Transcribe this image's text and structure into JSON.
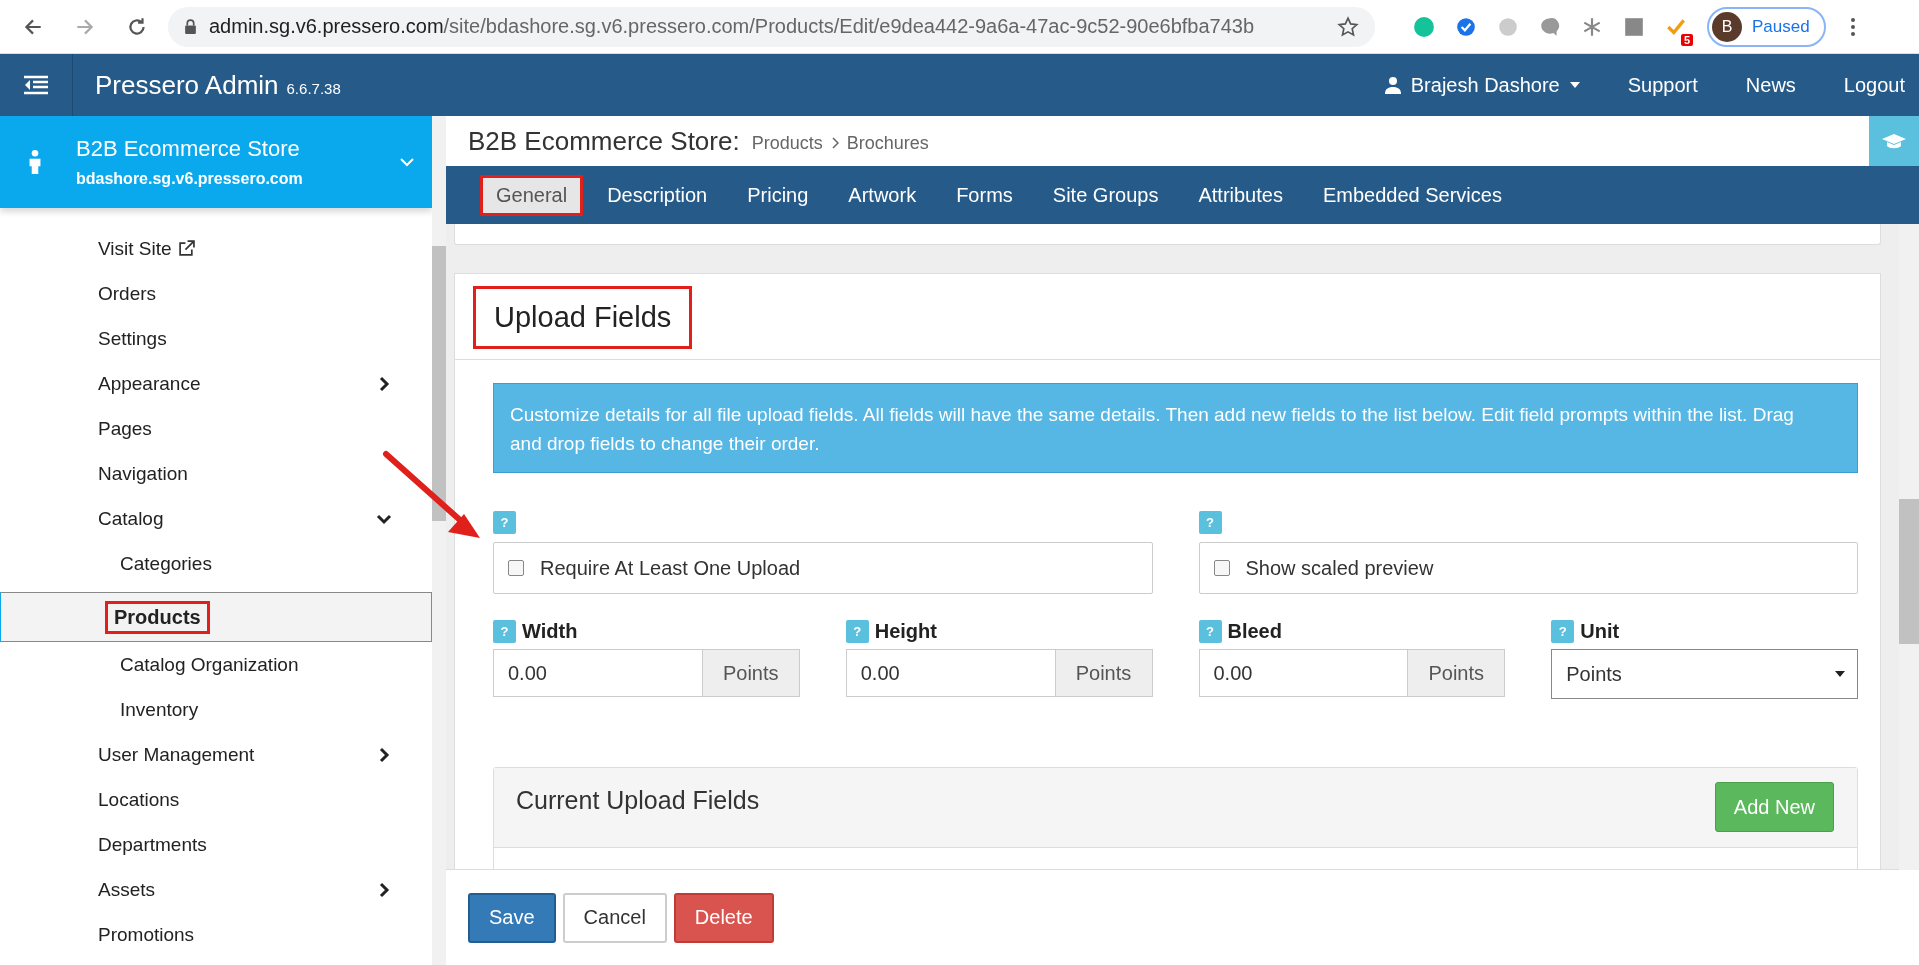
{
  "browser": {
    "url_host": "admin.sg.v6.pressero.com",
    "url_path": "/site/bdashore.sg.v6.pressero.com/Products/Edit/e9dea442-9a6a-47ac-9c52-90e6bfba743b",
    "extension_badge": "5",
    "profile_initial": "B",
    "profile_status": "Paused"
  },
  "header": {
    "title": "Pressero Admin",
    "version": "6.6.7.38",
    "user": "Brajesh Dashore",
    "links": [
      "Support",
      "News",
      "Logout"
    ]
  },
  "store": {
    "name": "B2B Ecommerce Store",
    "domain": "bdashore.sg.v6.pressero.com"
  },
  "sidebar": {
    "items": [
      {
        "label": "Visit Site",
        "kind": "external",
        "selected": false
      },
      {
        "label": "Orders",
        "kind": "link",
        "selected": false
      },
      {
        "label": "Settings",
        "kind": "link",
        "selected": false
      },
      {
        "label": "Appearance",
        "kind": "group",
        "expanded": false,
        "selected": false
      },
      {
        "label": "Pages",
        "kind": "link",
        "selected": false
      },
      {
        "label": "Navigation",
        "kind": "link",
        "selected": false
      },
      {
        "label": "Catalog",
        "kind": "group",
        "expanded": true,
        "selected": false,
        "children": [
          {
            "label": "Categories",
            "selected": false,
            "annotated": false
          },
          {
            "label": "Products",
            "selected": true,
            "annotated": true
          },
          {
            "label": "Catalog Organization",
            "selected": false,
            "annotated": false
          },
          {
            "label": "Inventory",
            "selected": false,
            "annotated": false
          }
        ]
      },
      {
        "label": "User Management",
        "kind": "group",
        "expanded": false,
        "selected": false
      },
      {
        "label": "Locations",
        "kind": "link",
        "selected": false
      },
      {
        "label": "Departments",
        "kind": "link",
        "selected": false
      },
      {
        "label": "Assets",
        "kind": "group",
        "expanded": false,
        "selected": false
      },
      {
        "label": "Promotions",
        "kind": "link",
        "selected": false
      }
    ]
  },
  "page": {
    "title": "B2B Ecommerce Store:",
    "breadcrumb": [
      "Products",
      "Brochures"
    ]
  },
  "tabs": [
    {
      "label": "General",
      "selected": true,
      "annotated": true
    },
    {
      "label": "Description",
      "selected": false,
      "annotated": false
    },
    {
      "label": "Pricing",
      "selected": false,
      "annotated": false
    },
    {
      "label": "Artwork",
      "selected": false,
      "annotated": false
    },
    {
      "label": "Forms",
      "selected": false,
      "annotated": false
    },
    {
      "label": "Site Groups",
      "selected": false,
      "annotated": false
    },
    {
      "label": "Attributes",
      "selected": false,
      "annotated": false
    },
    {
      "label": "Embedded Services",
      "selected": false,
      "annotated": false
    }
  ],
  "upload_fields": {
    "title": "Upload Fields",
    "annotated": true,
    "pointer_arrow": true,
    "info": "Customize details for all file upload fields. All fields will have the same details. Then add new fields to the list below. Edit field prompts within the list. Drag and drop fields to change their order.",
    "checkboxes": [
      {
        "help": "?",
        "label": "Require At Least One Upload",
        "checked": false
      },
      {
        "help": "?",
        "label": "Show scaled preview",
        "checked": false
      }
    ],
    "fields": [
      {
        "kind": "addon",
        "help": "?",
        "label": "Width",
        "value": "0.00",
        "unit": "Points"
      },
      {
        "kind": "addon",
        "help": "?",
        "label": "Height",
        "value": "0.00",
        "unit": "Points"
      },
      {
        "kind": "addon",
        "help": "?",
        "label": "Bleed",
        "value": "0.00",
        "unit": "Points"
      },
      {
        "kind": "select",
        "help": "?",
        "label": "Unit",
        "value": "Points"
      }
    ],
    "panel": {
      "title": "Current Upload Fields",
      "button": "Add New"
    }
  },
  "footer_buttons": [
    {
      "label": "Save",
      "kind": "primary"
    },
    {
      "label": "Cancel",
      "kind": "default"
    },
    {
      "label": "Delete",
      "kind": "danger"
    }
  ]
}
